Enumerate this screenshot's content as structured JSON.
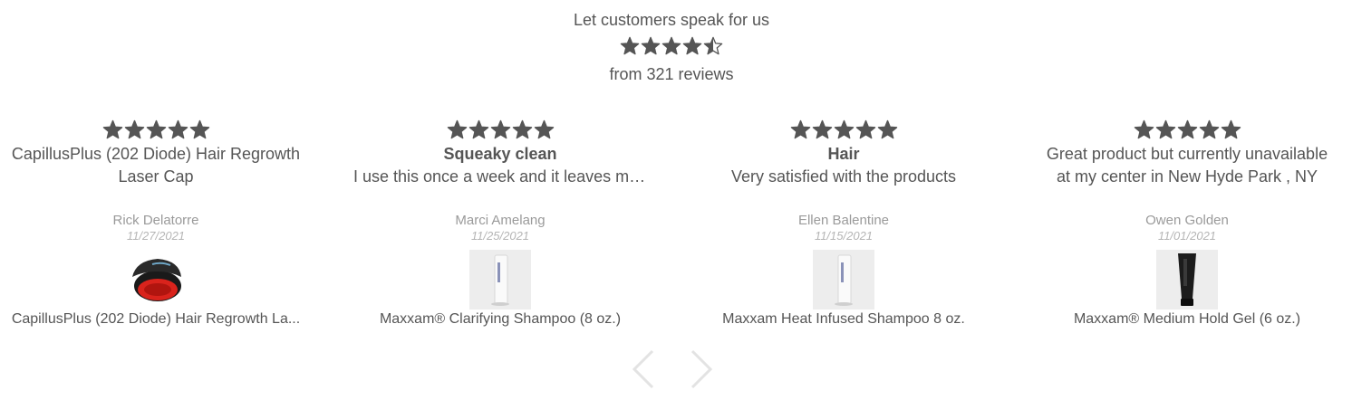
{
  "header": {
    "title": "Let customers speak for us",
    "rating": 4.5,
    "review_count_text": "from 321 reviews"
  },
  "reviews": [
    {
      "rating": 5,
      "title": "",
      "body": "CapillusPlus (202 Diode) Hair Regrowth Laser Cap",
      "author": "Rick Delatorre",
      "date": "11/27/2021",
      "product": "CapillusPlus (202 Diode) Hair Regrowth La...",
      "product_icon": "laser-cap-icon"
    },
    {
      "rating": 5,
      "title": "Squeaky clean",
      "body": "I use this once a week and it leaves my...",
      "author": "Marci Amelang",
      "date": "11/25/2021",
      "product": "Maxxam® Clarifying Shampoo (8 oz.)",
      "product_icon": "shampoo-bottle-icon"
    },
    {
      "rating": 5,
      "title": "Hair",
      "body": "Very satisfied with the products",
      "author": "Ellen Balentine",
      "date": "11/15/2021",
      "product": "Maxxam Heat Infused Shampoo 8 oz.",
      "product_icon": "shampoo-bottle-icon"
    },
    {
      "rating": 5,
      "title": "",
      "body": "Great product but currently unavailable at my center in New Hyde Park , NY",
      "author": "Owen Golden",
      "date": "11/01/2021",
      "product": "Maxxam® Medium Hold Gel (6 oz.)",
      "product_icon": "gel-tube-icon"
    }
  ],
  "navigation": {
    "prev_icon": "chevron-left-icon",
    "next_icon": "chevron-right-icon"
  },
  "colors": {
    "star": "#555555",
    "text": "#555555",
    "muted": "#9a9a9a",
    "arrow": "#e3e3e3"
  }
}
